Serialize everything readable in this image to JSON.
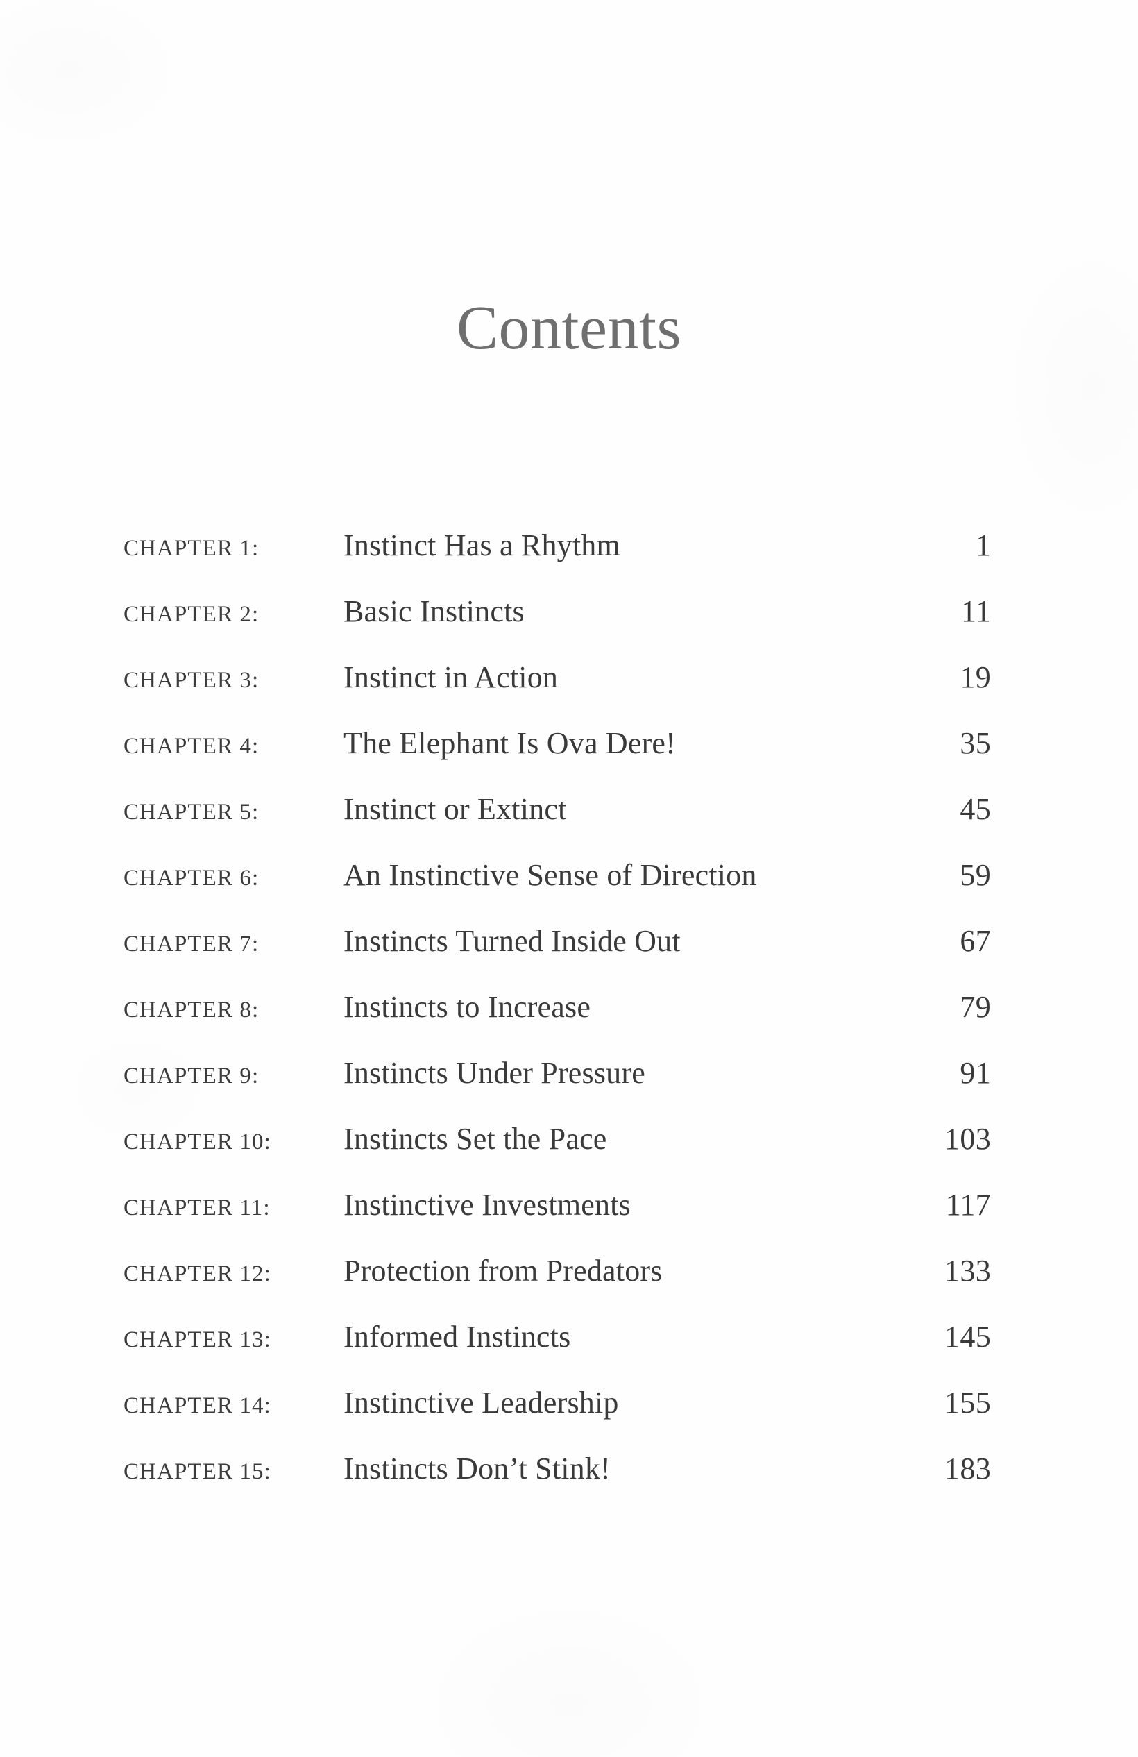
{
  "document": {
    "page_title": "Contents",
    "chapter_label_prefix": "CHAPTER",
    "chapter_label_suffix": ":"
  },
  "toc": {
    "entries": [
      {
        "label": "CHAPTER 1:",
        "title": "Instinct Has a Rhythm",
        "page": "1"
      },
      {
        "label": "CHAPTER 2:",
        "title": "Basic Instincts",
        "page": "11"
      },
      {
        "label": "CHAPTER 3:",
        "title": "Instinct in Action",
        "page": "19"
      },
      {
        "label": "CHAPTER 4:",
        "title": "The Elephant Is Ova Dere!",
        "page": "35"
      },
      {
        "label": "CHAPTER 5:",
        "title": "Instinct or Extinct",
        "page": "45"
      },
      {
        "label": "CHAPTER 6:",
        "title": "An Instinctive Sense of Direction",
        "page": "59"
      },
      {
        "label": "CHAPTER 7:",
        "title": "Instincts Turned Inside Out",
        "page": "67"
      },
      {
        "label": "CHAPTER 8:",
        "title": "Instincts to Increase",
        "page": "79"
      },
      {
        "label": "CHAPTER 9:",
        "title": "Instincts Under Pressure",
        "page": "91"
      },
      {
        "label": "CHAPTER 10:",
        "title": "Instincts Set the Pace",
        "page": "103"
      },
      {
        "label": "CHAPTER 11:",
        "title": "Instinctive Investments",
        "page": "117"
      },
      {
        "label": "CHAPTER 12:",
        "title": "Protection from Predators",
        "page": "133"
      },
      {
        "label": "CHAPTER 13:",
        "title": "Informed Instincts",
        "page": "145"
      },
      {
        "label": "CHAPTER 14:",
        "title": "Instinctive Leadership",
        "page": "155"
      },
      {
        "label": "CHAPTER 15:",
        "title": "Instincts Don’t Stink!",
        "page": "183"
      }
    ]
  },
  "colors": {
    "page_background": "#fefefe",
    "title_text": "#6f6f6f",
    "body_text": "#3a3a3a"
  }
}
